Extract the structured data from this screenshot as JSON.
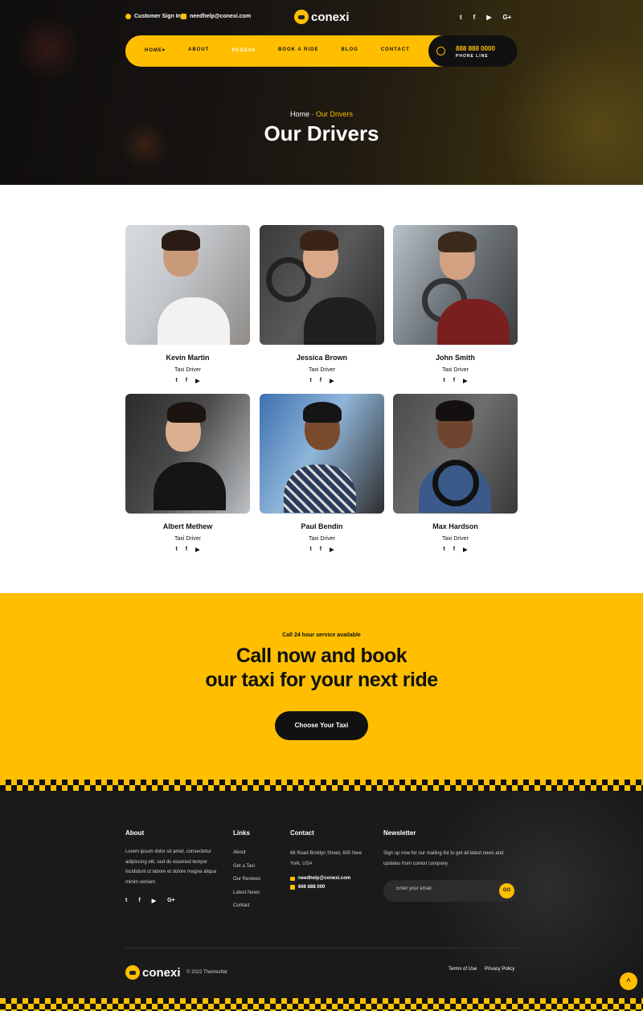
{
  "topbar": {
    "signin": "Customer Sign In",
    "email": "needhelp@conexi.com",
    "social": [
      "t",
      "f",
      "▶",
      "G+"
    ]
  },
  "brand": {
    "name": "conexi"
  },
  "nav": {
    "items": [
      "HOME▾",
      "ABOUT",
      "PAGES▾",
      "BOOK A RIDE",
      "BLOG",
      "CONTACT"
    ],
    "active_index": 2,
    "phone": "888 888 0000",
    "phone_label": "PHONE LINE"
  },
  "hero": {
    "crumb_home": "Home",
    "crumb_sep": "·",
    "crumb_current": "Our Drivers",
    "title": "Our Drivers"
  },
  "drivers": [
    {
      "name": "Kevin Martin",
      "role": "Taxi Driver"
    },
    {
      "name": "Jessica Brown",
      "role": "Taxi Driver"
    },
    {
      "name": "John Smith",
      "role": "Taxi Driver"
    },
    {
      "name": "Albert Methew",
      "role": "Taxi Driver"
    },
    {
      "name": "Paul Bendin",
      "role": "Taxi Driver"
    },
    {
      "name": "Max Hardson",
      "role": "Taxi Driver"
    }
  ],
  "driver_social": [
    "t",
    "f",
    "▶"
  ],
  "cta": {
    "small": "Call 24 hour service available",
    "line1": "Call now and book",
    "line2": "our taxi for your next ride",
    "button": "Choose Your Taxi"
  },
  "footer": {
    "about_title": "About",
    "about_text": "Lorem ipsum dolor sit amet, consectetur adipiscing elit, sed do eiusmod tempor incididunt ut labore et dolore magna aliqua minim veniam",
    "links_title": "Links",
    "links": [
      "About",
      "Get a Taxi",
      "Our Reviews",
      "Latest News",
      "Contact"
    ],
    "contact_title": "Contact",
    "address": "66 Road Broklyn Street, 600 New York, USA",
    "email": "needhelp@conexi.com",
    "phone": "666 888 000",
    "newsletter_title": "Newsletter",
    "newsletter_text": "Sign up now for our mailing list to get all latest news and updates from conexi company.",
    "placeholder": "Enter your email",
    "go": "GO",
    "copyright": "© 2022 Themesflat",
    "terms": "Terms of Use",
    "privacy": "Privacy Policy",
    "social": [
      "t",
      "f",
      "▶",
      "G+"
    ]
  },
  "colors": {
    "accent": "#ffbf00",
    "dark": "#111111"
  },
  "to_top": "^"
}
